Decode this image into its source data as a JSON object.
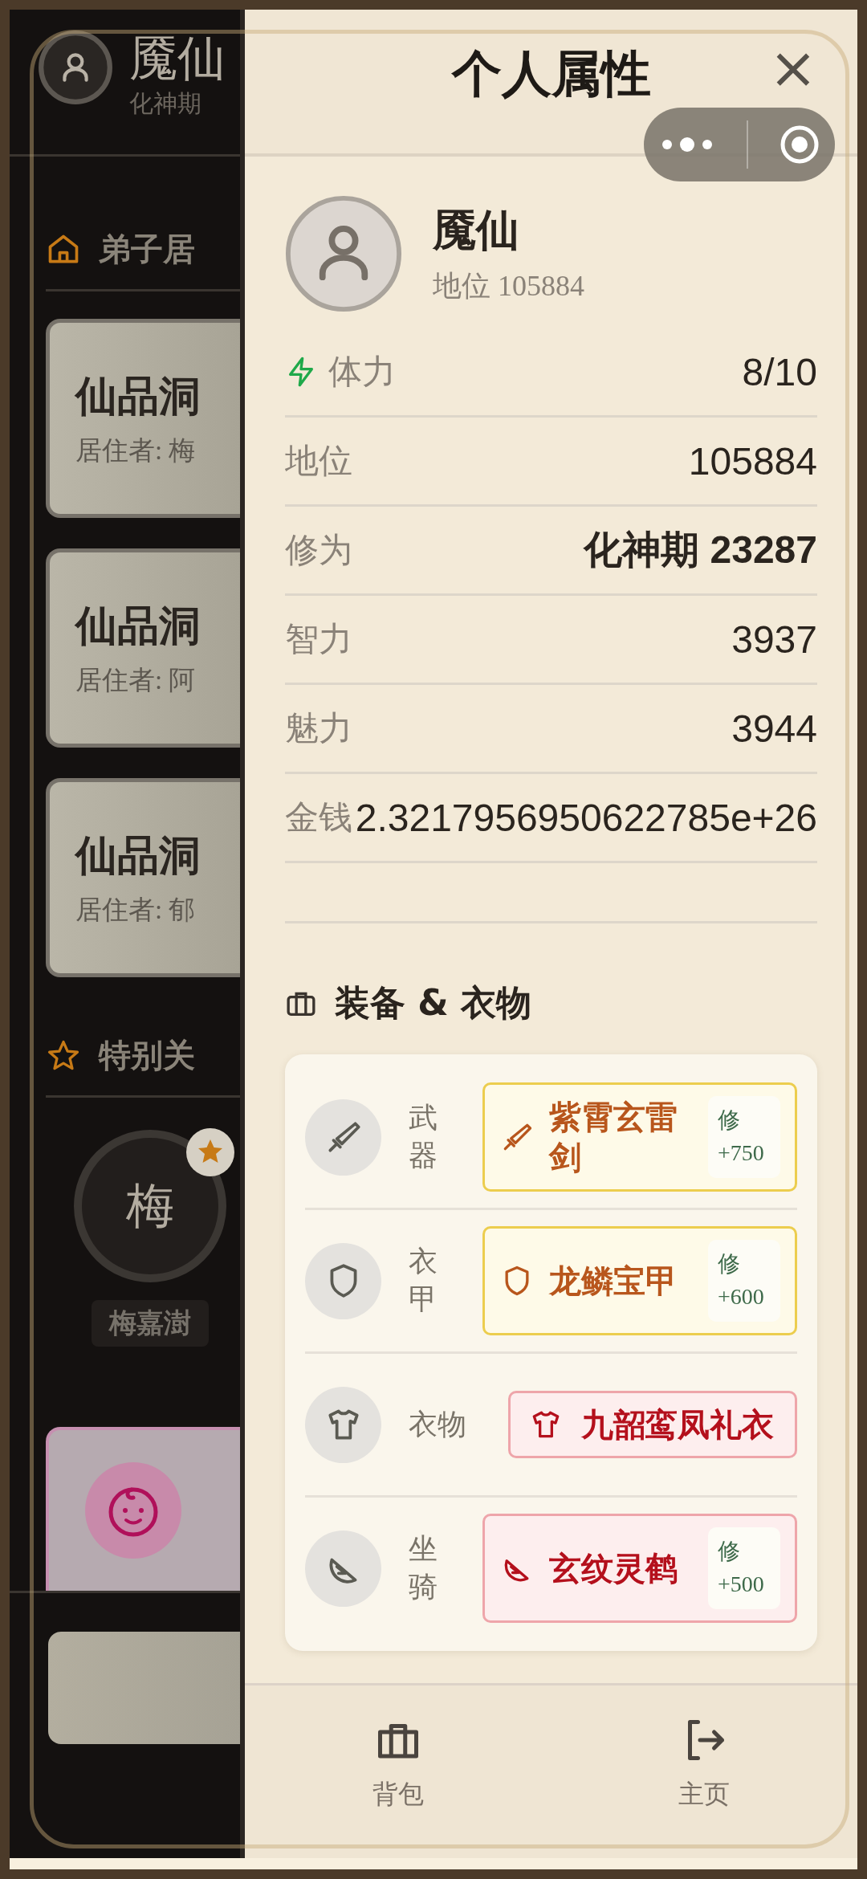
{
  "background_page": {
    "user": {
      "name": "魇仙",
      "realm": "化神期"
    },
    "residence_section": {
      "title": "弟子居"
    },
    "residences": [
      {
        "title": "仙品洞",
        "resident": "居住者: 梅"
      },
      {
        "title": "仙品洞",
        "resident": "居住者: 阿"
      },
      {
        "title": "仙品洞",
        "resident": "居住者: 郁"
      }
    ],
    "favorites_section": {
      "title": "特别关"
    },
    "favorites": [
      {
        "initial": "梅",
        "name": "梅嘉澍",
        "starred": true
      }
    ]
  },
  "panel": {
    "title": "个人属性",
    "close": "×",
    "profile": {
      "name": "魇仙",
      "subtitle": "地位 105884"
    },
    "stats": [
      {
        "label": "体力",
        "value": "8/10",
        "kind": "energy"
      },
      {
        "label": "地位",
        "value": "105884",
        "kind": "plain"
      },
      {
        "label": "修为",
        "value": "化神期 23287",
        "kind": "plain"
      },
      {
        "label": "智力",
        "value": "3937",
        "kind": "plain"
      },
      {
        "label": "魅力",
        "value": "3944",
        "kind": "plain"
      },
      {
        "label": "金钱",
        "value": "2.3217956950622785e+26",
        "kind": "plain"
      }
    ],
    "equipment_title": "装备 & 衣物",
    "equipment": [
      {
        "slot": "武器",
        "item": "紫霄玄雷剑",
        "kind": "gold",
        "bonus": "修 +750"
      },
      {
        "slot": "衣甲",
        "item": "龙鳞宝甲",
        "kind": "gold",
        "bonus": "修 +600"
      },
      {
        "slot": "衣物",
        "item": "九韶鸾凤礼衣",
        "kind": "red"
      },
      {
        "slot": "坐骑",
        "item": "玄纹灵鹤",
        "kind": "red",
        "bonus": "修 +500"
      }
    ],
    "nav": [
      {
        "label": "背包"
      },
      {
        "label": "主页"
      }
    ]
  }
}
